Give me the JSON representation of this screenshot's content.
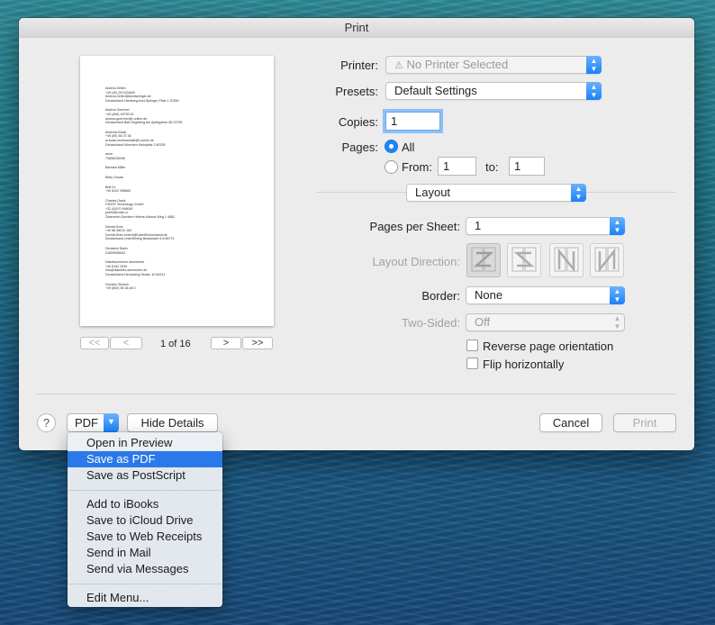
{
  "window": {
    "title": "Print"
  },
  "preview": {
    "page_indicator": "1 of 16",
    "first_label": "<<",
    "prev_label": "<",
    "next_label": ">",
    "last_label": ">>",
    "page_lines": [
      [
        "Andrea Zeiten",
        "+49 (40) 3471(0)600",
        "Andrea.Zeiten@axelspringer.de",
        "Deutschland Hamburg Axel-Springer-Platz 1 20350"
      ],
      [
        "Andrea Goertner",
        "+49 (456) 18795 62",
        "andrea-goertner@t-online.de",
        "Deutschland Bad Segeberg Am Apfelgarten 58 23795"
      ],
      [
        "Andreas Bozik",
        "+49 (89) 56 37 38",
        "ai.bozik.rechtsanwalt@t-online.de",
        "Deutschland München Karlsplatz 3 80335"
      ],
      [
        "anon",
        "73658236396"
      ],
      [
        "Barbara Miller"
      ],
      [
        "Betty Gossic"
      ],
      [
        "Britt Dr",
        "+49 8102 998860"
      ],
      [
        "Charles Dauls",
        "CRATE Technology GmbH",
        "+32 (0)570 998060",
        "public@crate.io",
        "Österreich Dornbirn Helene-Kalmar-Weg 1 4862"
      ],
      [
        "Dennis Bree",
        "+49 88 98010 160",
        "Dennis.Bree.extern@KabelDeutschland.de",
        "Deutschland Unterföhring Betastraße 6-8 85774"
      ],
      [
        "Deutsche Bahn",
        "01805996633"
      ],
      [
        "Diabetszentrum Ammersee",
        "+49 8152 2939",
        "info@diabetes-ammersee.de",
        "Deutschland Herrsching Seestr. 40 82211"
      ],
      [
        "Dominic Strickrh",
        "+49 (800) 55 38 48 0"
      ]
    ]
  },
  "settings": {
    "printer_label": "Printer:",
    "printer_value": "No Printer Selected",
    "presets_label": "Presets:",
    "presets_value": "Default Settings",
    "copies_label": "Copies:",
    "copies_value": "1",
    "pages_label": "Pages:",
    "pages_all_label": "All",
    "pages_from_label": "From:",
    "pages_from_value": "1",
    "pages_to_label": "to:",
    "pages_to_value": "1",
    "section_value": "Layout",
    "pages_per_sheet_label": "Pages per Sheet:",
    "pages_per_sheet_value": "1",
    "layout_direction_label": "Layout Direction:",
    "border_label": "Border:",
    "border_value": "None",
    "two_sided_label": "Two-Sided:",
    "two_sided_value": "Off",
    "reverse_label": "Reverse page orientation",
    "flip_label": "Flip horizontally"
  },
  "footer": {
    "help_label": "?",
    "pdf_label": "PDF",
    "hide_details_label": "Hide Details",
    "cancel_label": "Cancel",
    "print_label": "Print"
  },
  "pdf_menu": {
    "group1": [
      "Open in Preview",
      "Save as PDF",
      "Save as PostScript"
    ],
    "group2": [
      "Add to iBooks",
      "Save to iCloud Drive",
      "Save to Web Receipts",
      "Send in Mail",
      "Send via Messages"
    ],
    "group3": [
      "Edit Menu..."
    ],
    "highlighted": "Save as PDF"
  },
  "icons": {
    "warning": "warning-icon",
    "popup_arrows": "up-down-chevron-icon",
    "dropdown": "chevron-down-icon"
  },
  "colors": {
    "accent": "#1f84f9",
    "menu_highlight": "#2b79e8"
  }
}
